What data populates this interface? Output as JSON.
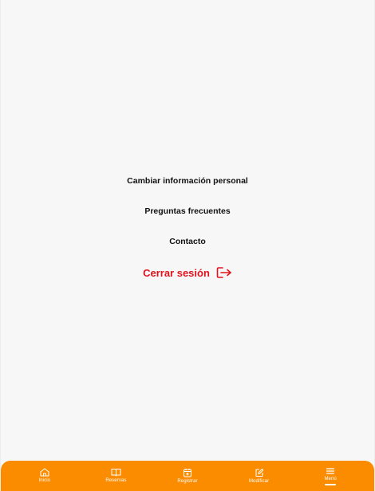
{
  "menu": {
    "items": [
      {
        "label": "Cambiar información personal"
      },
      {
        "label": "Preguntas frecuentes"
      },
      {
        "label": "Contacto"
      }
    ],
    "logout_label": "Cerrar sesión"
  },
  "bottom_nav": {
    "items": [
      {
        "label": "Inicio",
        "icon": "home-icon"
      },
      {
        "label": "Reservas",
        "icon": "book-icon"
      },
      {
        "label": "Registrar",
        "icon": "calendar-add-icon"
      },
      {
        "label": "Modificar",
        "icon": "edit-icon"
      },
      {
        "label": "Menú",
        "icon": "menu-icon",
        "active": true
      }
    ]
  },
  "colors": {
    "nav_background": "#fb8c00",
    "logout_red": "#e0141e",
    "screen_background": "#f7f7f7"
  }
}
